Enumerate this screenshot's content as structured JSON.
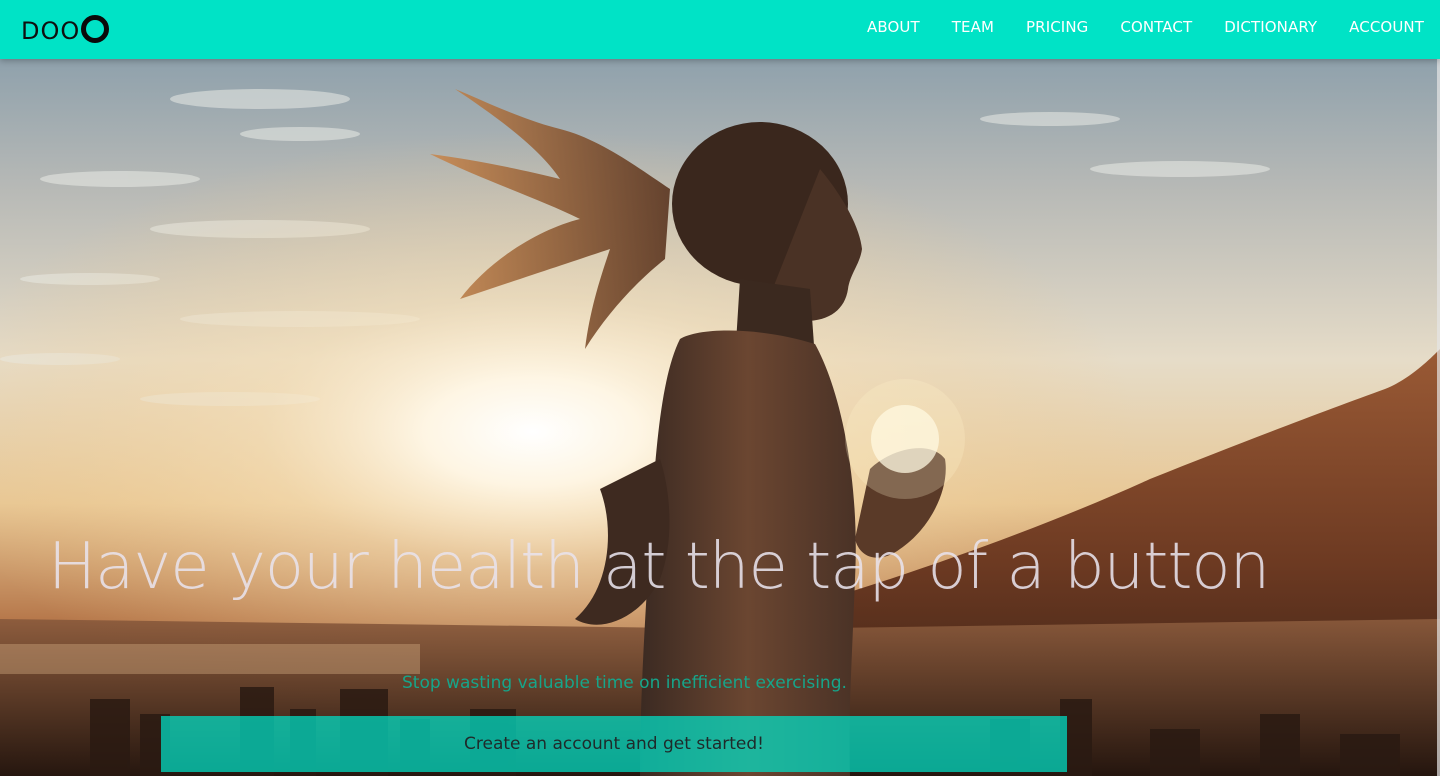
{
  "brand": {
    "logo_text": "DOO",
    "logo_icon": "ring-icon"
  },
  "nav": {
    "items": [
      {
        "label": "ABOUT"
      },
      {
        "label": "TEAM"
      },
      {
        "label": "PRICING"
      },
      {
        "label": "CONTACT"
      },
      {
        "label": "DICTIONARY"
      },
      {
        "label": "ACCOUNT"
      }
    ]
  },
  "hero": {
    "headline": "Have your health at the tap of a button",
    "subheadline": "Stop wasting valuable time on inefficient exercising.",
    "cta_label": "Create an account and get started!",
    "photo_subject": "woman-running-at-sunrise-photo"
  },
  "colors": {
    "navbar_bg": "#00e3c6",
    "cta_bg": "rgba(0, 224, 200, 0.72)",
    "subheadline": "#16a58a",
    "headline": "#e8e2ec"
  }
}
